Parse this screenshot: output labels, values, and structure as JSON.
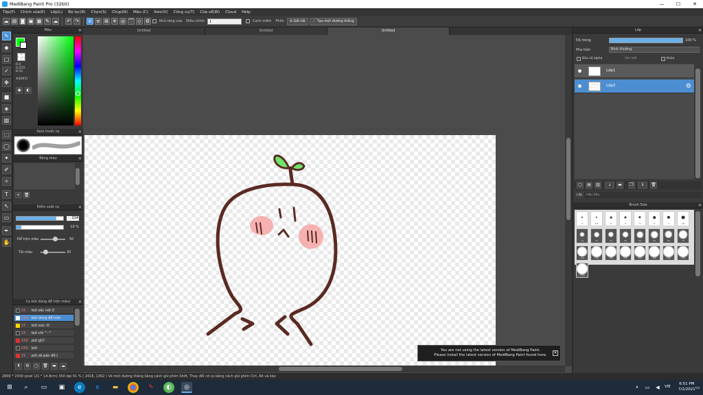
{
  "window": {
    "title": "MediBang Paint Pro (32bit)",
    "minimize": "—",
    "maximize": "☐",
    "close": "✕"
  },
  "menu": [
    "Tệp(F)",
    "Chỉnh sửa(E)",
    "Lớp(L)",
    "Bộ lọc(R)",
    "Chọn(S)",
    "Chụp(N)",
    "Màu (C)",
    "Xem(V)",
    "Công cụ(T)",
    "Cửa sổ(W)",
    "Cloud",
    "Help"
  ],
  "toolbar": {
    "antialias_label": "Khử răng cưa",
    "correction_label": "Điều chỉnh",
    "correction_value": "1",
    "edge_label": "Canh mềm",
    "snap_label": "Phím",
    "snap_off_label": "Gắt tắt",
    "create_line_label": "Tạo một đường thẳng"
  },
  "tabs": [
    "Untitled",
    "Untitled",
    "Untitled"
  ],
  "panels": {
    "color": {
      "title": "Màu",
      "r": "R:0",
      "g": "G:255",
      "b": "B:31",
      "hex": "#00ff1f"
    },
    "preview": {
      "title": "Xem trước cọ"
    },
    "palette": {
      "title": "Bảng màu"
    },
    "brush_control": {
      "title": "Kiểm soát cọ",
      "size_value": "114",
      "opacity_value": "10 %",
      "blend_label": "Để trộn màu",
      "blend_value": "50",
      "reload_label": "Tải màu",
      "reload_value": "30"
    },
    "brush_list": {
      "title": "Cọ bút dùng để trộn màu)",
      "items": [
        {
          "size": "15",
          "name": "bút sắc nét:3",
          "color": "#3a3a3a"
        },
        {
          "size": "114",
          "name": "bút dùng để trộn",
          "color": "#4d8ed2"
        },
        {
          "size": "15",
          "name": "bút sưu :D",
          "color": "#ffd700"
        },
        {
          "size": "15",
          "name": "bút chì ^-^",
          "color": "#3a3a3a"
        },
        {
          "size": "150",
          "name": "pút gì)?",
          "color": "#e03030"
        },
        {
          "size": "150",
          "name": "bút",
          "color": "#3a3a3a"
        },
        {
          "size": "15",
          "name": "pút zẽ pán đồ:)",
          "color": "#e03030"
        }
      ]
    },
    "layer": {
      "title": "Lớp",
      "opacity_label": "Độ trong",
      "opacity_value": "100 %",
      "blend_label": "Pha trộn",
      "blend_value": "Bình thường",
      "protect_alpha": "Bảo vệ alpha",
      "clipping": "Xén bớt",
      "lock": "Khóa",
      "layers": [
        "Lớp1",
        "Lớp2"
      ],
      "tabs": [
        "Lớp",
        "Hậu tiêu"
      ]
    },
    "brush_size": {
      "title": "Brush Size",
      "sizes": [
        "1",
        "1.5",
        "2",
        "3",
        "4",
        "5",
        "7",
        "10",
        "12",
        "15",
        "20",
        "25",
        "30",
        "40",
        "50",
        "70",
        "100",
        "150",
        "200",
        "250",
        "300",
        "400",
        "500",
        "700",
        "1000"
      ]
    }
  },
  "notice": {
    "line1": "You are not using the latest version of MediBang Paint.",
    "line2": "Please install the latest version of MediBang Paint found here."
  },
  "status": "2800 * 2030 pixel  (21 * 14.8cm)  350 dpi  41 %  ( 2418, 1362 )  Vẽ một đường thẳng bằng cách giữ phím Shift, Thay đổi cỡ cọ bằng cách giữ phím Ctrl, Alt và kéo",
  "taskbar": {
    "lang": "VIE",
    "time": "6:51 PM",
    "date": "7/2/2021"
  },
  "colors": {
    "accent": "#4d8ed2",
    "stroke": "#5a2a22",
    "leaf": "#6ce66c",
    "blush": "#f6a5a5"
  }
}
